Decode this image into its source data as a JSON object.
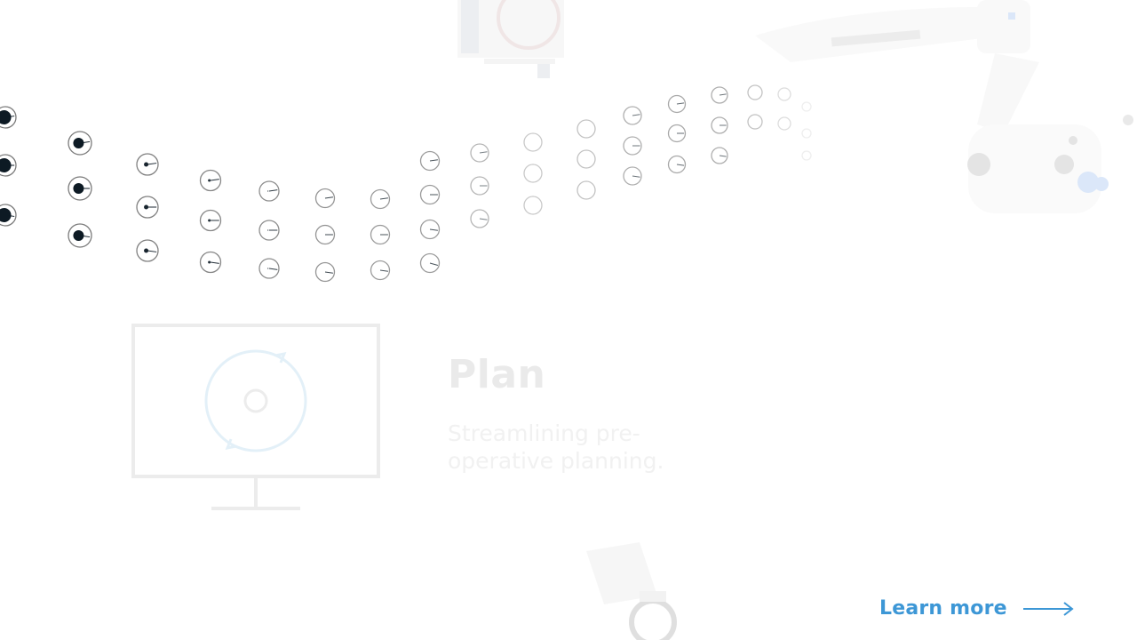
{
  "plan": {
    "title": "Plan",
    "subtitle": "Streamlining pre-operative planning."
  },
  "cta": {
    "label": "Learn more",
    "icon": "arrow-right-icon"
  },
  "icons": {
    "plan": "monitor-cycle-icon"
  },
  "colors": {
    "accent": "#3d97d6",
    "dot_dark": "#0d1a24",
    "dot_ring": "#7a7a7a",
    "faded_text": "#eaeaea",
    "faded_icon": "#ececec",
    "faded_icon_accent": "#e3f0f8"
  }
}
